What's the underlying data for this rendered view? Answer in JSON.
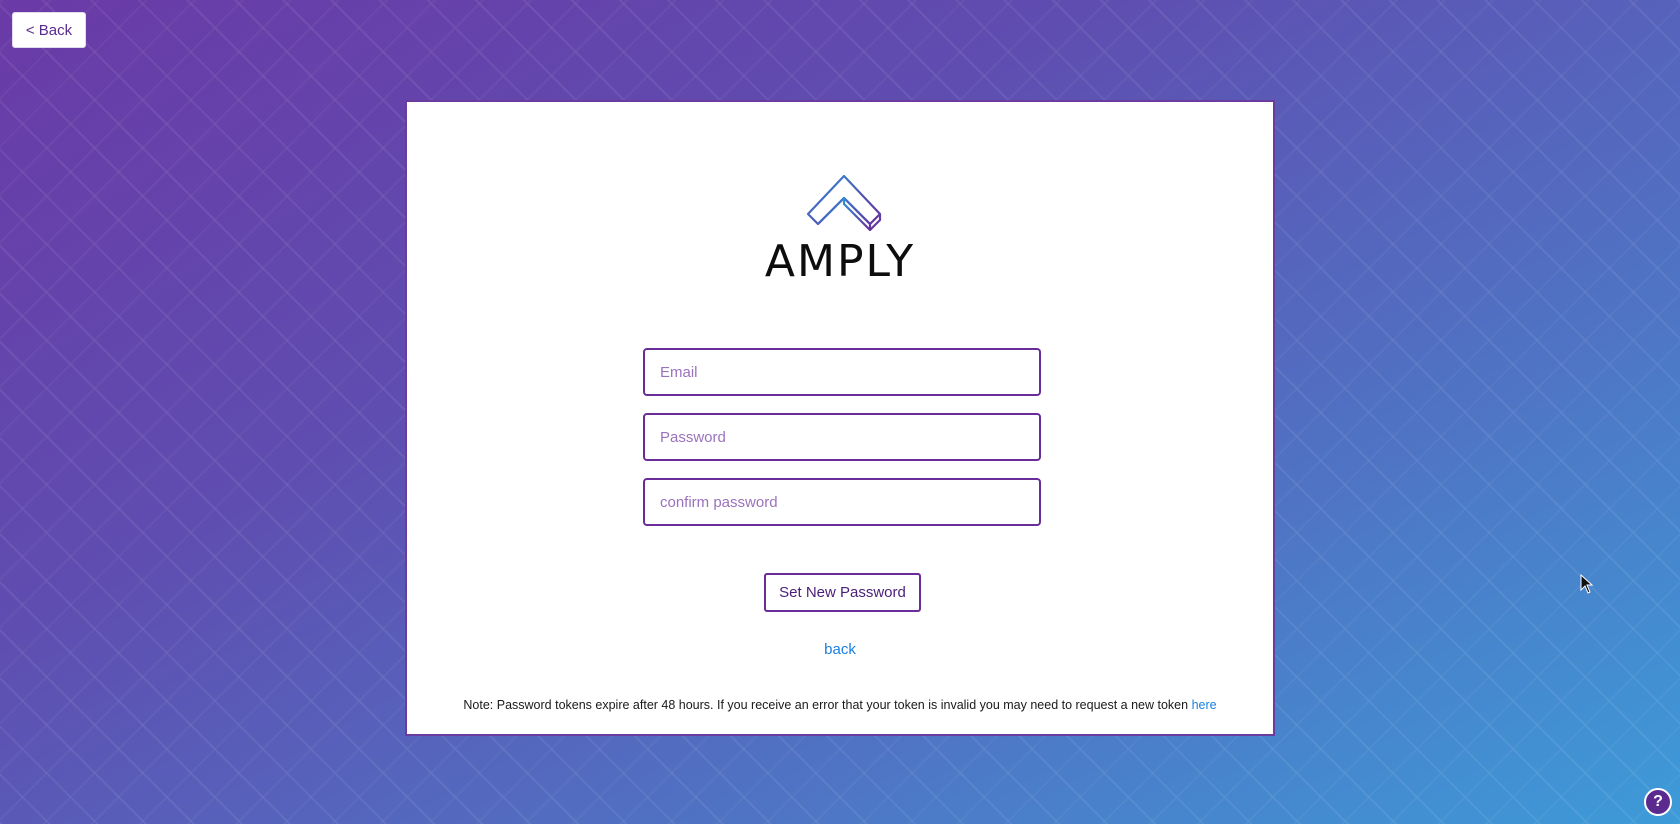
{
  "nav": {
    "back_label": "< Back"
  },
  "brand": {
    "name": "AMPLY",
    "logo_icon": "amply-chevron-logo-icon",
    "colors": {
      "primary": "#6a2c98",
      "link": "#1a7fe0"
    }
  },
  "form": {
    "email_placeholder": "Email",
    "password_placeholder": "Password",
    "confirm_placeholder": "confirm password",
    "submit_label": "Set New Password",
    "back_link": "back"
  },
  "note": {
    "text": "Note: Password tokens expire after 48 hours. If you receive an error that your token is invalid you may need to request a new token ",
    "link_label": "here"
  },
  "help": {
    "label": "?",
    "icon": "help-question-icon"
  }
}
